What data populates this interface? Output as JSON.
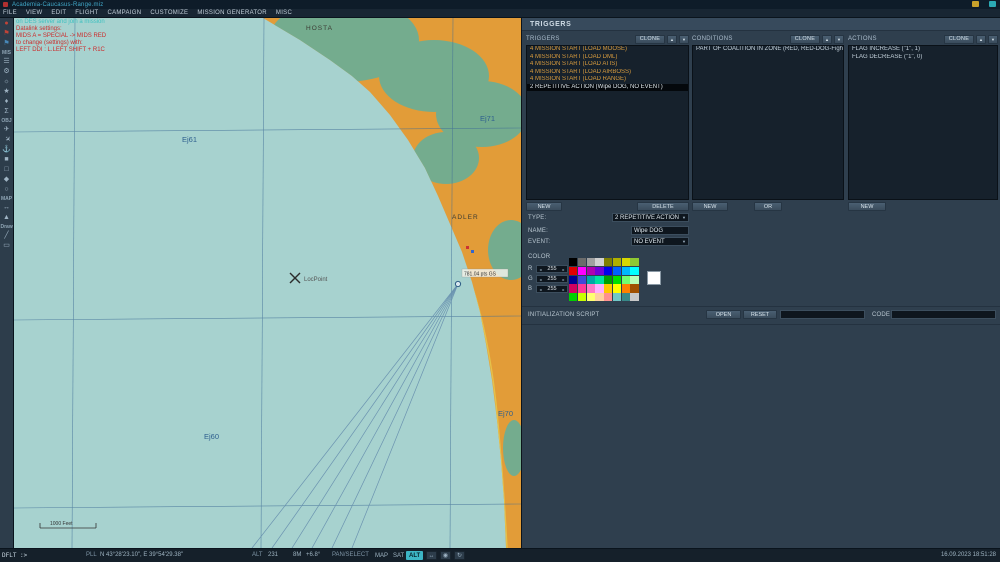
{
  "window": {
    "title": "Academia-Caucasus-Range.miz"
  },
  "menu": {
    "items": [
      "FILE",
      "VIEW",
      "EDIT",
      "FLIGHT",
      "CAMPAIGN",
      "CUSTOMIZE",
      "MISSION GENERATOR",
      "MISC"
    ]
  },
  "icons": {
    "up": "▲",
    "down": "▼",
    "dropdown": "▼",
    "dec": "◂",
    "inc": "▸",
    "ruler": "↔",
    "target": "◉",
    "rotate": "↻"
  },
  "toolbar": {
    "items": [
      {
        "t": "icon",
        "name": "record-icon",
        "g": "●",
        "c": "#c04438"
      },
      {
        "t": "icon",
        "name": "red-flag-icon",
        "g": "⚑",
        "c": "#c04438"
      },
      {
        "t": "icon",
        "name": "blue-flag-icon",
        "g": "⚑",
        "c": "#4888b8"
      },
      {
        "t": "label",
        "name": "toolbar-section-mis",
        "g": "MIS"
      },
      {
        "t": "icon",
        "name": "briefing-icon",
        "g": "☰"
      },
      {
        "t": "icon",
        "name": "options-icon",
        "g": "⚙"
      },
      {
        "t": "icon",
        "name": "weather-icon",
        "g": "☼"
      },
      {
        "t": "icon",
        "name": "goals-icon",
        "g": "★"
      },
      {
        "t": "icon",
        "name": "failures-icon",
        "g": "♦"
      },
      {
        "t": "icon",
        "name": "summary-icon",
        "g": "Σ"
      },
      {
        "t": "label",
        "name": "toolbar-section-obj",
        "g": "OBJ"
      },
      {
        "t": "icon",
        "name": "airplane-group-icon",
        "g": "✈"
      },
      {
        "t": "icon",
        "name": "helicopter-group-icon",
        "g": "✈",
        "r": 1
      },
      {
        "t": "icon",
        "name": "ship-group-icon",
        "g": "⚓"
      },
      {
        "t": "icon",
        "name": "vehicle-group-icon",
        "g": "■"
      },
      {
        "t": "icon",
        "name": "static-object-icon",
        "g": "□"
      },
      {
        "t": "icon",
        "name": "template-icon",
        "g": "◆"
      },
      {
        "t": "icon",
        "name": "trigger-zone-icon",
        "g": "○"
      },
      {
        "t": "label",
        "name": "toolbar-section-map",
        "g": "MAP"
      },
      {
        "t": "icon",
        "name": "ruler-icon",
        "g": "↔"
      },
      {
        "t": "icon",
        "name": "map-marker-icon",
        "g": "▲"
      },
      {
        "t": "label",
        "name": "toolbar-section-draw",
        "g": "Draw"
      },
      {
        "t": "icon",
        "name": "draw-line-icon",
        "g": "╱"
      },
      {
        "t": "icon",
        "name": "draw-shape-icon",
        "g": "▭"
      }
    ]
  },
  "map": {
    "overlay_lines": [
      {
        "text": "on DES server and join a mission",
        "color": "#3ec0c0"
      },
      {
        "text": "Datalink settings:",
        "color": "#cc2b2b"
      },
      {
        "text": "MIDS A = SPECIAL -> MIDS RED",
        "color": "#cc2b2b"
      },
      {
        "text": "to change (settings) with:",
        "color": "#cc2b2b"
      },
      {
        "text": "LEFT DDI : L.LEFT SHIFT + R1C",
        "color": "#cc2b2b"
      }
    ],
    "labels": {
      "city1": "HOSTA",
      "city2": "ADLER",
      "grid1": "Ej61",
      "grid2": "Ej71",
      "grid3": "Ej60",
      "grid4": "Ej70"
    },
    "waypoint_label": "LocPoint",
    "airport_label": "781.04 pts GS",
    "scale_label": "1000 Feet",
    "colors": {
      "water": "#a7d2cf",
      "land": "#e29c38",
      "forest": "#74ac8e",
      "grid": "#3f6d96",
      "road": "#e5c14a"
    }
  },
  "triggers_panel": {
    "title": "TRIGGERS",
    "clone_label": "CLONE",
    "columns": {
      "triggers": {
        "header": "TRIGGERS",
        "items": [
          {
            "text": "4 MISSION START (LOAD MOOSE)"
          },
          {
            "text": "4 MISSION START (LOAD DML)"
          },
          {
            "text": "4 MISSION START (LOAD ATIS)"
          },
          {
            "text": "4 MISSION START (LOAD AIRBOSS)"
          },
          {
            "text": "4 MISSION START (LOAD RANGE)"
          },
          {
            "text": "2 REPETITIVE ACTION (Wipe DOG, NO EVENT)",
            "selected": true
          }
        ],
        "new_label": "NEW",
        "delete_label": "DELETE"
      },
      "conditions": {
        "header": "CONDITIONS",
        "items": [
          "PART OF COALITION IN ZONE (RED, RED-DOG-Fight, AIRPLANE)"
        ],
        "new_label": "NEW",
        "or_label": "OR"
      },
      "actions": {
        "header": "ACTIONS",
        "items": [
          "FLAG INCREASE (\"1\", 1)",
          "FLAG DECREASE (\"1\", 0)"
        ],
        "new_label": "NEW"
      }
    },
    "form": {
      "type_label": "TYPE:",
      "type_value": "2 REPETITIVE ACTION",
      "name_label": "NAME:",
      "name_value": "Wipe DOG",
      "event_label": "EVENT:",
      "event_value": "NO EVENT",
      "color_label": "COLOR"
    },
    "rgb": [
      {
        "channel": "R",
        "value": "255"
      },
      {
        "channel": "G",
        "value": "255"
      },
      {
        "channel": "B",
        "value": "255"
      }
    ],
    "palette": [
      [
        "#000000",
        "#6b6b6b",
        "#a0a0a0",
        "#d0d0d0",
        "#7f7f00",
        "#b0b000",
        "#d8d800",
        "#8fc832"
      ],
      [
        "#e00000",
        "#ff00ff",
        "#b000b0",
        "#7000d8",
        "#0000e8",
        "#0060ff",
        "#00b8ff",
        "#00ffff"
      ],
      [
        "#000090",
        "#4048d8",
        "#00a8a8",
        "#00e0a0",
        "#00a000",
        "#00e000",
        "#70ff70",
        "#b8ffb8"
      ],
      [
        "#d00060",
        "#ff3898",
        "#ff78c8",
        "#ffb0ff",
        "#ffc800",
        "#ffff00",
        "#ff8000",
        "#a05000"
      ],
      [
        "#00d000",
        "#c8ff00",
        "#ffff70",
        "#ffd0a0",
        "#ff9090",
        "#70c8c8",
        "#388888",
        "#c8c8c8"
      ]
    ],
    "selected_color": "#ffffff",
    "script": {
      "label": "INITIALIZATION SCRIPT",
      "open_label": "OPEN",
      "reset_label": "RESET",
      "code_label": "CODE"
    }
  },
  "statusbar": {
    "prompt": "DFLT :>",
    "pll_label": "PLL",
    "coords": "N 43°28'23.10\", E 39°54'29.38\"",
    "alt_label": "ALT",
    "alt_value": "231",
    "scale": "8M",
    "heading": "+6.8°",
    "mode": "PAN/SELECT",
    "map_label": "MAP",
    "sat_label": "SAT",
    "alt_button": "ALT",
    "datetime": "16.09.2023 18:51:28"
  }
}
